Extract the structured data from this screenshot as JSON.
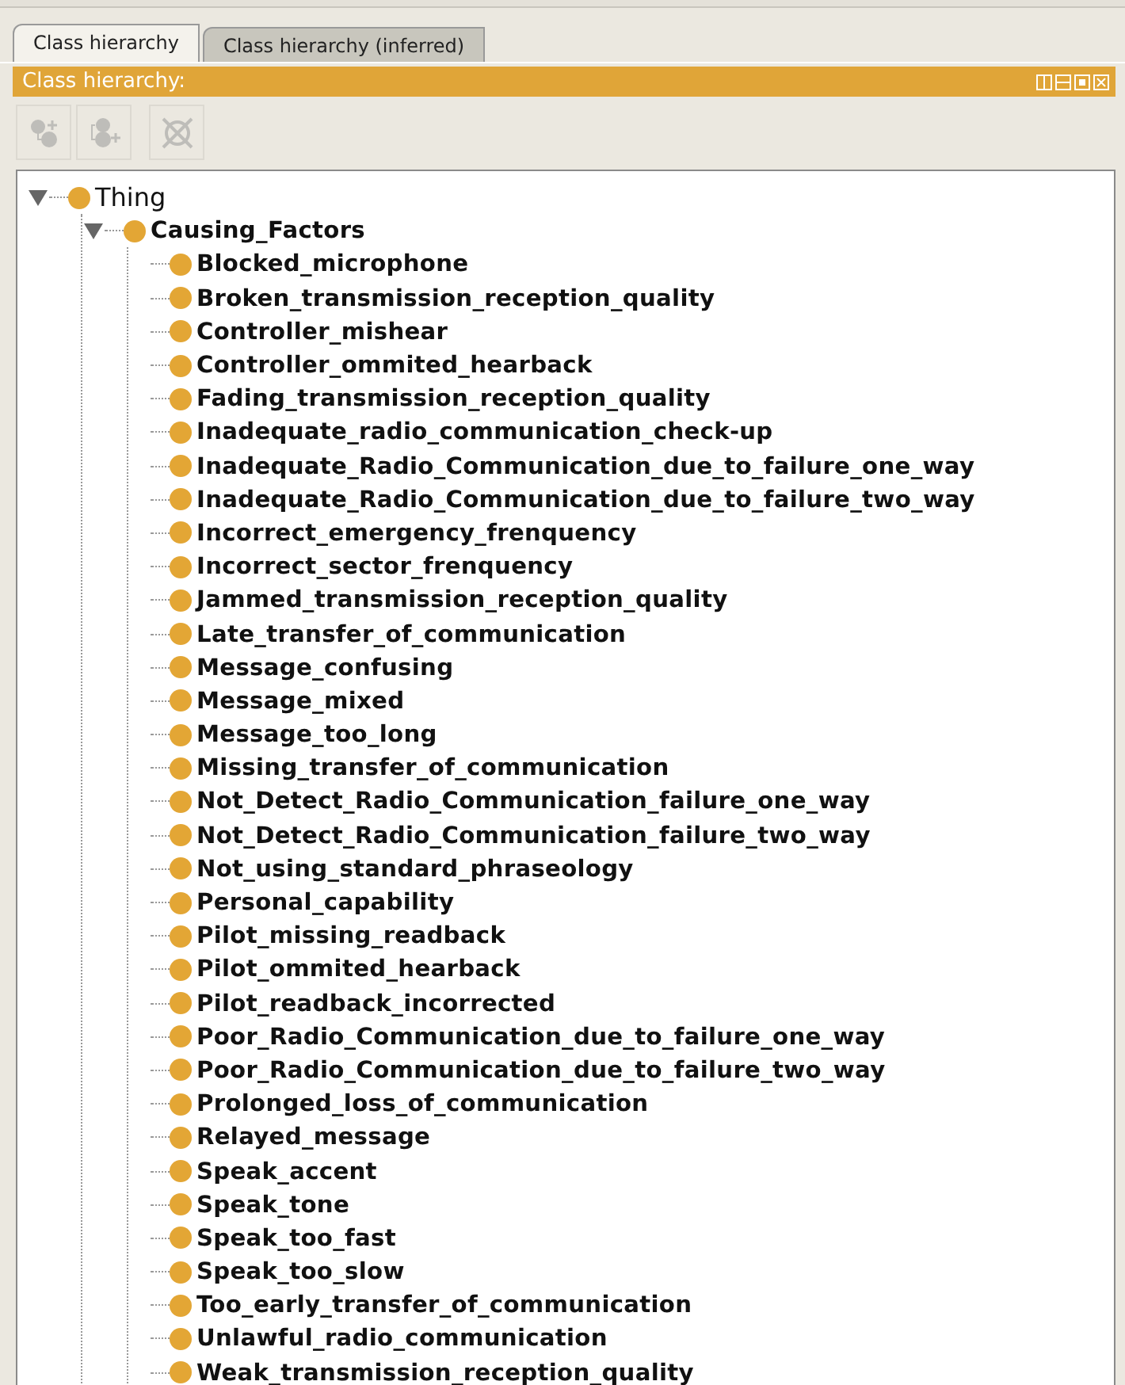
{
  "tabs": [
    {
      "label": "Class hierarchy",
      "selected": true
    },
    {
      "label": "Class hierarchy (inferred)",
      "selected": false
    }
  ],
  "view": {
    "title": "Class hierarchy:"
  },
  "toolbar": [
    {
      "kind": "add-subclass",
      "disabled": true
    },
    {
      "kind": "add-sibling",
      "disabled": true
    },
    {
      "kind": "delete",
      "disabled": true
    }
  ],
  "tree": [
    {
      "label": "Thing",
      "bold": false,
      "expanded": true,
      "children": [
        {
          "label": "Causing_Factors",
          "bold": true,
          "expanded": true,
          "children": [
            {
              "label": "Blocked_microphone",
              "bold": true
            },
            {
              "label": "Broken_transmission_reception_quality",
              "bold": true
            },
            {
              "label": "Controller_mishear",
              "bold": true
            },
            {
              "label": "Controller_ommited_hearback",
              "bold": true
            },
            {
              "label": "Fading_transmission_reception_quality",
              "bold": true
            },
            {
              "label": "Inadequate_radio_communication_check-up",
              "bold": true
            },
            {
              "label": "Inadequate_Radio_Communication_due_to_failure_one_way",
              "bold": true
            },
            {
              "label": "Inadequate_Radio_Communication_due_to_failure_two_way",
              "bold": true
            },
            {
              "label": "Incorrect_emergency_frenquency",
              "bold": true
            },
            {
              "label": "Incorrect_sector_frenquency",
              "bold": true
            },
            {
              "label": "Jammed_transmission_reception_quality",
              "bold": true
            },
            {
              "label": "Late_transfer_of_communication",
              "bold": true
            },
            {
              "label": "Message_confusing",
              "bold": true
            },
            {
              "label": "Message_mixed",
              "bold": true
            },
            {
              "label": "Message_too_long",
              "bold": true
            },
            {
              "label": "Missing_transfer_of_communication",
              "bold": true
            },
            {
              "label": "Not_Detect_Radio_Communication_failure_one_way",
              "bold": true
            },
            {
              "label": "Not_Detect_Radio_Communication_failure_two_way",
              "bold": true
            },
            {
              "label": "Not_using_standard_phraseology",
              "bold": true
            },
            {
              "label": "Personal_capability",
              "bold": true
            },
            {
              "label": "Pilot_missing_readback",
              "bold": true
            },
            {
              "label": "Pilot_ommited_hearback",
              "bold": true
            },
            {
              "label": "Pilot_readback_incorrected",
              "bold": true
            },
            {
              "label": "Poor_Radio_Communication_due_to_failure_one_way",
              "bold": true
            },
            {
              "label": "Poor_Radio_Communication_due_to_failure_two_way",
              "bold": true
            },
            {
              "label": "Prolonged_loss_of_communication",
              "bold": true
            },
            {
              "label": "Relayed_message",
              "bold": true
            },
            {
              "label": "Speak_accent",
              "bold": true
            },
            {
              "label": "Speak_tone",
              "bold": true
            },
            {
              "label": "Speak_too_fast",
              "bold": true
            },
            {
              "label": "Speak_too_slow",
              "bold": true
            },
            {
              "label": "Too_early_transfer_of_communication",
              "bold": true
            },
            {
              "label": "Unlawful_radio_communication",
              "bold": true
            },
            {
              "label": "Weak_transmission_reception_quality",
              "bold": true
            }
          ]
        }
      ]
    }
  ]
}
